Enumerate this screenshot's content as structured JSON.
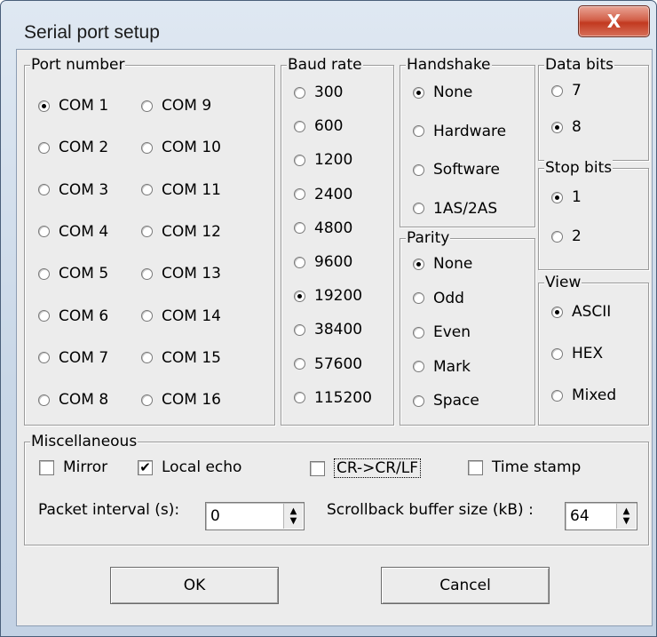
{
  "window": {
    "title": "Serial port setup",
    "close_symbol": "X"
  },
  "port_number": {
    "label": "Port number",
    "left": [
      "COM 1",
      "COM 2",
      "COM 3",
      "COM 4",
      "COM 5",
      "COM 6",
      "COM 7",
      "COM 8"
    ],
    "right": [
      "COM 9",
      "COM 10",
      "COM 11",
      "COM 12",
      "COM 13",
      "COM 14",
      "COM 15",
      "COM 16"
    ],
    "selected": "COM 1"
  },
  "baud_rate": {
    "label": "Baud rate",
    "options": [
      "300",
      "600",
      "1200",
      "2400",
      "4800",
      "9600",
      "19200",
      "38400",
      "57600",
      "115200"
    ],
    "selected": "19200"
  },
  "handshake": {
    "label": "Handshake",
    "options": [
      "None",
      "Hardware",
      "Software",
      "1AS/2AS"
    ],
    "selected": "None"
  },
  "parity": {
    "label": "Parity",
    "options": [
      "None",
      "Odd",
      "Even",
      "Mark",
      "Space"
    ],
    "selected": "None"
  },
  "data_bits": {
    "label": "Data bits",
    "options": [
      "7",
      "8"
    ],
    "selected": "8"
  },
  "stop_bits": {
    "label": "Stop bits",
    "options": [
      "1",
      "2"
    ],
    "selected": "1"
  },
  "view": {
    "label": "View",
    "options": [
      "ASCII",
      "HEX",
      "Mixed"
    ],
    "selected": "ASCII"
  },
  "misc": {
    "label": "Miscellaneous",
    "mirror_label": "Mirror",
    "mirror_checked": false,
    "local_echo_label": "Local echo",
    "local_echo_checked": true,
    "crlf_label": "CR->CR/LF",
    "crlf_checked": false,
    "timestamp_label": "Time stamp",
    "timestamp_checked": false,
    "packet_interval_label": "Packet interval (s):",
    "packet_interval_value": "0",
    "scrollback_label": "Scrollback buffer size (kB) :",
    "scrollback_value": "64"
  },
  "buttons": {
    "ok": "OK",
    "cancel": "Cancel"
  },
  "icons": {
    "spin_up": "▲",
    "spin_down": "▼",
    "check_mark": "✔"
  }
}
